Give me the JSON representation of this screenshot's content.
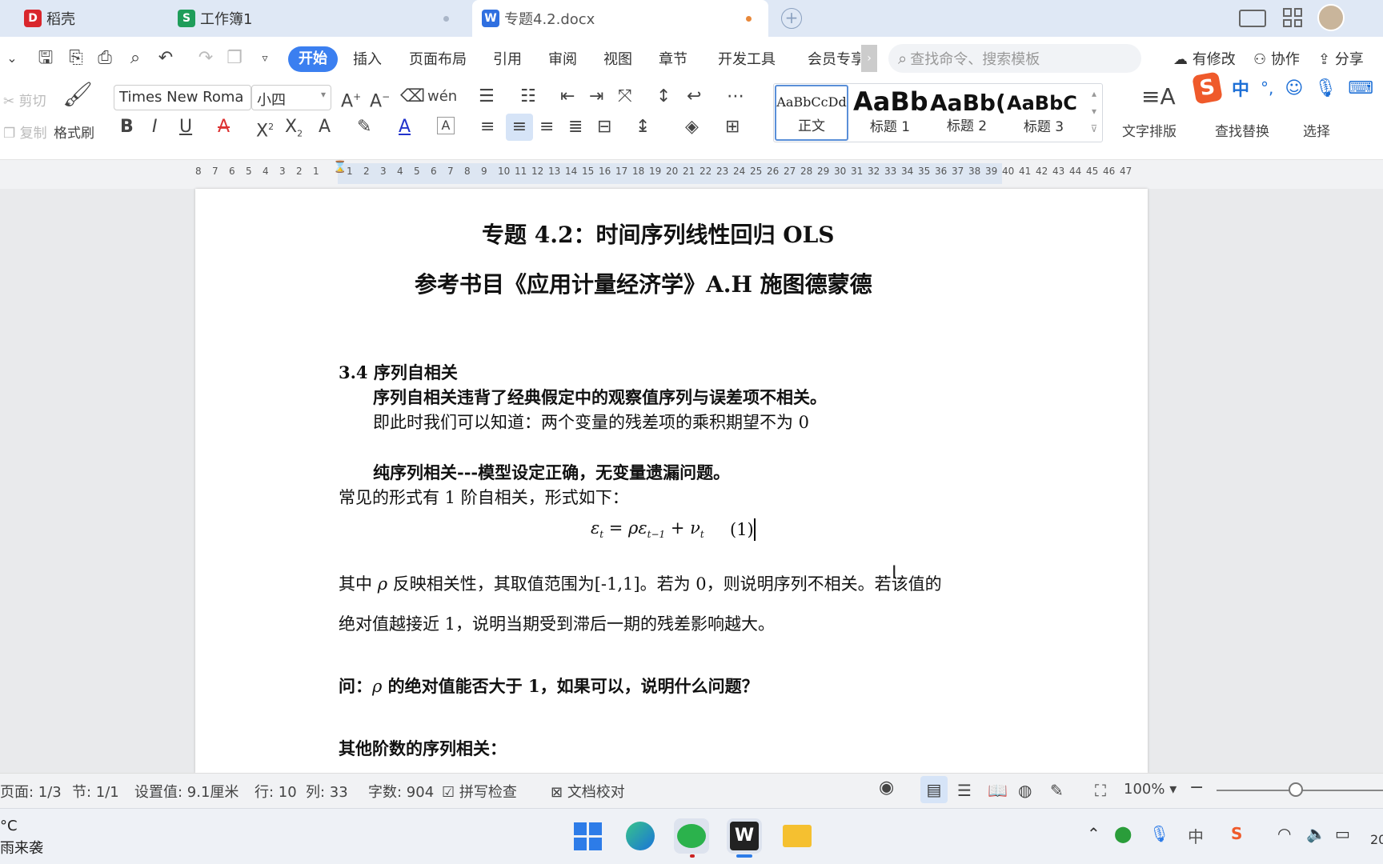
{
  "tabs": [
    {
      "label": "稻壳",
      "icon": "daoke-icon"
    },
    {
      "label": "工作簿1",
      "icon": "spreadsheet-icon"
    },
    {
      "label": "专题4.2.docx",
      "icon": "word-doc-icon"
    }
  ],
  "menu": [
    "开始",
    "插入",
    "页面布局",
    "引用",
    "审阅",
    "视图",
    "章节",
    "开发工具",
    "会员专享"
  ],
  "search_placeholder": "查找命令、搜索模板",
  "top_right": {
    "revise": "有修改",
    "collab": "协作",
    "share": "分享"
  },
  "ribbon": {
    "cut": "剪切",
    "copy": "复制",
    "format_painter": "格式刷",
    "font": "Times New Roma",
    "size": "小四",
    "styles": [
      {
        "preview": "AaBbCcDd",
        "label": "正文"
      },
      {
        "preview": "AaBb",
        "label": "标题 1"
      },
      {
        "preview": "AaBb(",
        "label": "标题 2"
      },
      {
        "preview": "AaBbC",
        "label": "标题 3"
      }
    ],
    "text_layout": "文字排版",
    "find_replace": "查找替换",
    "select": "选择"
  },
  "ime": {
    "lang": "中",
    "punct": "°,"
  },
  "ruler_marks": [
    "8",
    "7",
    "6",
    "5",
    "4",
    "3",
    "2",
    "1",
    "",
    "1",
    "2",
    "3",
    "4",
    "5",
    "6",
    "7",
    "8",
    "9",
    "10",
    "11",
    "12",
    "13",
    "14",
    "15",
    "16",
    "17",
    "18",
    "19",
    "20",
    "21",
    "22",
    "23",
    "24",
    "25",
    "26",
    "27",
    "28",
    "29",
    "30",
    "31",
    "32",
    "33",
    "34",
    "35",
    "36",
    "37",
    "38",
    "39",
    "40",
    "41",
    "42",
    "43",
    "44",
    "45",
    "46",
    "47"
  ],
  "document": {
    "title": "专题 4.2：时间序列线性回归 OLS",
    "subtitle": "参考书目《应用计量经济学》A.H 施图德蒙德",
    "section": "3.4 序列自相关",
    "line1": "序列自相关违背了经典假定中的观察值序列与误差项不相关。",
    "line2": "即此时我们可以知道：两个变量的残差项的乘积期望不为 0",
    "line3": "纯序列相关---模型设定正确，无变量遗漏问题。",
    "line4": "常见的形式有 1 阶自相关，形式如下：",
    "eq_lhs": "ε",
    "eq_lhs_sub": "t",
    "eq_mid": " = ρε",
    "eq_mid_sub": "t−1",
    "eq_rhs": " + ν",
    "eq_rhs_sub": "t",
    "eq_num": "(1)",
    "line5a": "其中",
    "line5rho": "ρ",
    "line5b": "反映相关性，其取值范围为[-1,1]。若为 0，则说明序列不相关。若该值的",
    "line6": "绝对值越接近 1，说明当期受到滞后一期的残差影响越大。",
    "q_prefix": "问：",
    "q_rho": "ρ",
    "q_text": "的绝对值能否大于 1，如果可以，说明什么问题？",
    "line8": "其他阶数的序列相关："
  },
  "status": {
    "page": "页面: 1/3",
    "section": "节: 1/1",
    "setting": "设置值: 9.1厘米",
    "row": "行: 10",
    "col": "列: 33",
    "words": "字数: 904",
    "spell": "拼写检查",
    "proof": "文档校对",
    "zoom": "100%"
  },
  "weather": {
    "temp": "°C",
    "desc": "雨来袭"
  },
  "tray": {
    "lang": "中",
    "clock": "20"
  }
}
